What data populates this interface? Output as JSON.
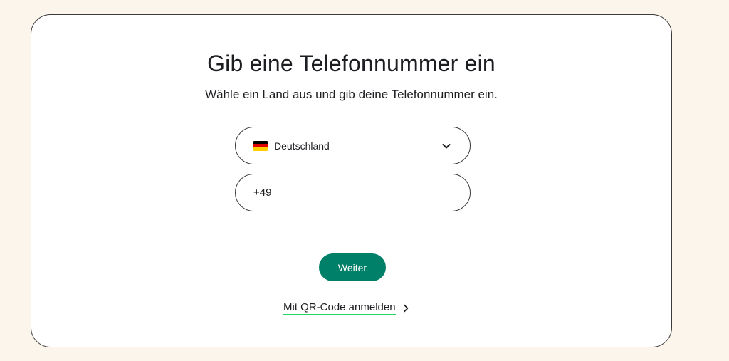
{
  "page": {
    "title": "Gib eine Telefonnummer ein",
    "subtitle": "Wähle ein Land aus und gib deine Telefonnummer ein."
  },
  "country_select": {
    "flag_icon": "germany-flag-icon",
    "selected_value": "Deutschland",
    "dropdown_icon": "chevron-down-icon"
  },
  "phone_field": {
    "value": "+49"
  },
  "actions": {
    "next_label": "Weiter",
    "qr_link_label": "Mit QR-Code anmelden",
    "qr_link_icon": "chevron-right-icon"
  },
  "colors": {
    "page_background": "#fcf5eb",
    "accent_green": "#008069",
    "link_underline": "#25d366",
    "card_border": "#3b3b3b"
  }
}
